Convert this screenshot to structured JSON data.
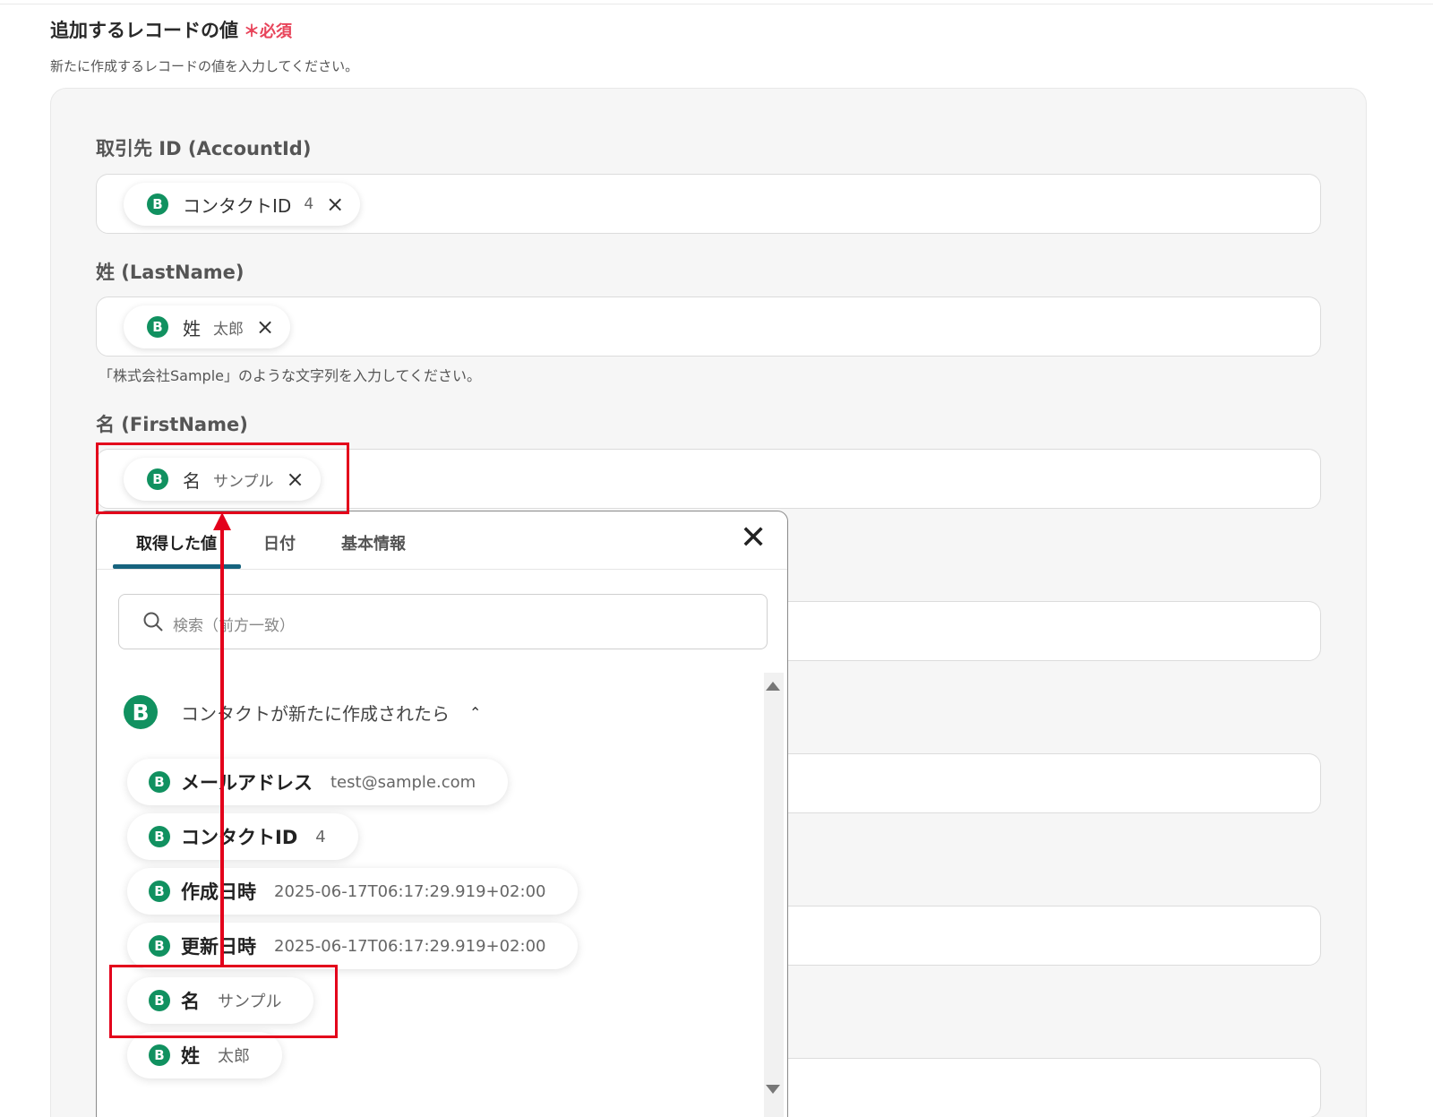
{
  "section": {
    "title": "追加するレコードの値",
    "required_mark": "＊必須",
    "description": "新たに作成するレコードの値を入力してください。"
  },
  "fields": [
    {
      "label": "取引先 ID (AccountId)",
      "chip": {
        "name": "コンタクトID",
        "value": "4"
      }
    },
    {
      "label": "姓 (LastName)",
      "chip": {
        "name": "姓",
        "value": "太郎"
      },
      "hint": "「株式会社Sample」のような文字列を入力してください。"
    },
    {
      "label": "名 (FirstName)",
      "chip": {
        "name": "名",
        "value": "サンプル"
      }
    }
  ],
  "icons": {
    "badge": "B",
    "remove": "×",
    "close": "✕",
    "chevron_up": "⌃"
  },
  "popup": {
    "tabs": [
      "取得した値",
      "日付",
      "基本情報"
    ],
    "active_tab": 0,
    "search_placeholder": "検索（前方一致）",
    "group_title": "コンタクトが新たに作成されたら",
    "items": [
      {
        "name": "メールアドレス",
        "value": "test@sample.com"
      },
      {
        "name": "コンタクトID",
        "value": "4"
      },
      {
        "name": "作成日時",
        "value": "2025-06-17T06:17:29.919+02:00"
      },
      {
        "name": "更新日時",
        "value": "2025-06-17T06:17:29.919+02:00"
      },
      {
        "name": "名",
        "value": "サンプル"
      },
      {
        "name": "姓",
        "value": "太郎"
      }
    ]
  },
  "colors": {
    "accent_green": "#119160",
    "required_red": "#e8445a",
    "highlight_red": "#e3001b",
    "tab_underline": "#16637e"
  }
}
